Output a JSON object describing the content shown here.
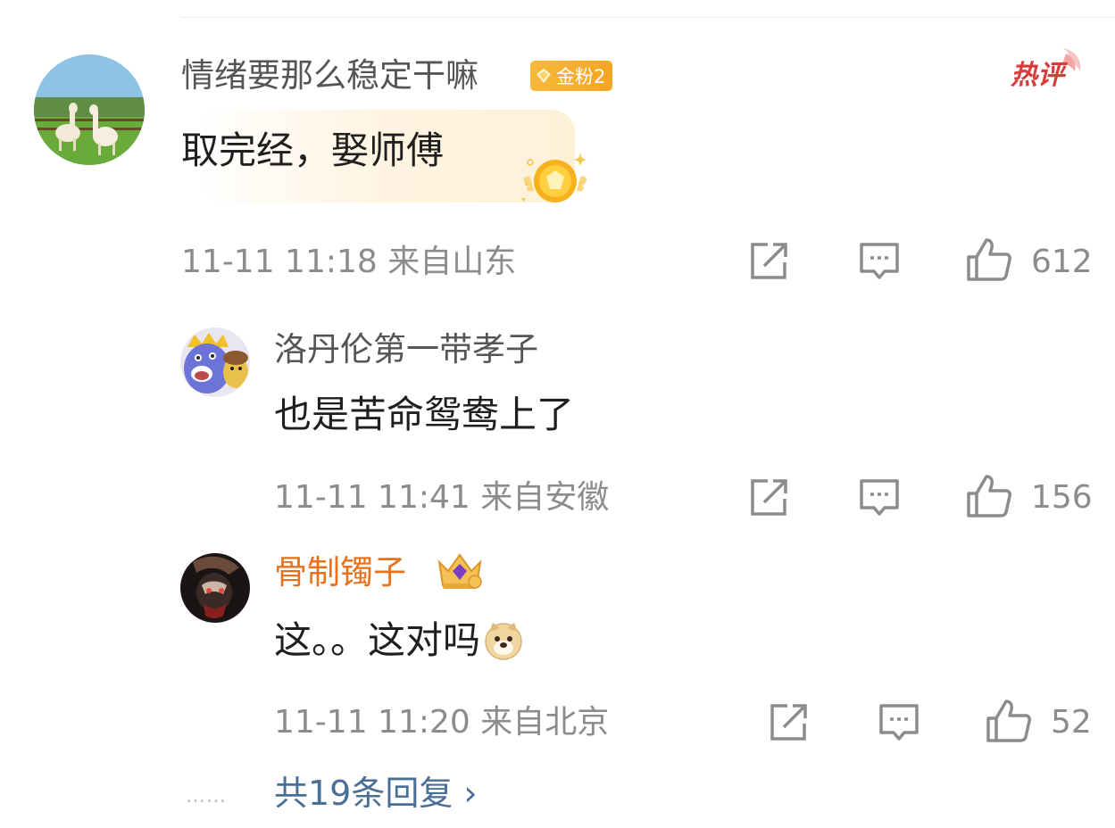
{
  "comment": {
    "username": "情绪要那么稳定干嘛",
    "badge_label": "金粉2",
    "hot_tag": "热评",
    "content": "取完经，娶师傅",
    "meta": "11-11 11:18 来自山东",
    "likes": "612",
    "avatar_icon": "alpaca-avatar"
  },
  "replies": [
    {
      "username": "洛丹伦第一带孝子",
      "content": "也是苦命鸳鸯上了",
      "meta": "11-11 11:41 来自安徽",
      "likes": "156",
      "avatar_icon": "cartoon-monster-avatar"
    },
    {
      "username": "骨制镯子",
      "content": "这。。这对吗",
      "meta": "11-11 11:20 来自北京",
      "likes": "52",
      "avatar_icon": "dark-character-avatar",
      "name_color": "#e8711a",
      "emoji_icon": "doge-emoji"
    }
  ],
  "more_replies": {
    "dots": "……",
    "label": "共19条回复 ›"
  },
  "colors": {
    "meta_gray": "#8c8c8c",
    "link_blue": "#4a6f96",
    "badge_gold": "#f3a623",
    "hot_red": "#d93a3a"
  }
}
